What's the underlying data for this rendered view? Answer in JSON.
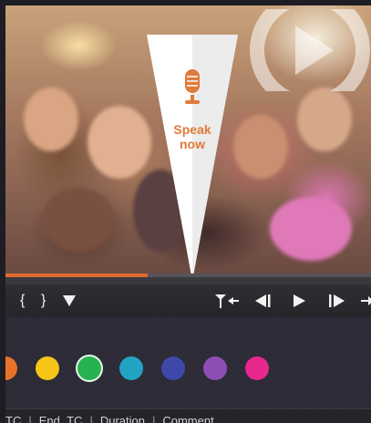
{
  "speak_button": {
    "label_line1": "Speak",
    "label_line2": "now",
    "accent_color": "#e07a3a"
  },
  "playback": {
    "progress_percent": 39
  },
  "toolbar": {
    "icons": [
      "brace-open-icon",
      "brace-close-icon",
      "marker-down-icon",
      "mark-in-icon",
      "step-back-icon",
      "play-icon",
      "step-forward-icon",
      "mark-out-icon"
    ]
  },
  "colors": [
    "#e8722a",
    "#f5c518",
    "#27b14f",
    "#22a3c4",
    "#3d48a8",
    "#8e4db5",
    "#e8278f"
  ],
  "columns": {
    "start_tc": "TC",
    "end_tc": "End_TC",
    "duration": "Duration",
    "comment": "Comment",
    "separator": "|"
  }
}
